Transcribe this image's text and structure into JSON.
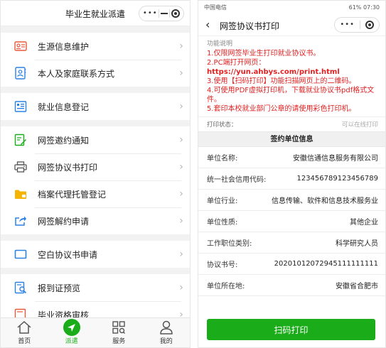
{
  "left": {
    "title": "毕业生就业派遣",
    "groups": [
      [
        {
          "label": "生源信息维护",
          "icon": "id-card-icon"
        },
        {
          "label": "本人及家庭联系方式",
          "icon": "contacts-icon"
        }
      ],
      [
        {
          "label": "就业信息登记",
          "icon": "building-icon"
        }
      ],
      [
        {
          "label": "网签邀约通知",
          "icon": "edit-document-icon"
        },
        {
          "label": "网签协议书打印",
          "icon": "printer-icon"
        },
        {
          "label": "档案代理托管登记",
          "icon": "folder-icon"
        },
        {
          "label": "网签解约申请",
          "icon": "share-out-icon"
        }
      ],
      [
        {
          "label": "空白协议书申请",
          "icon": "blank-form-icon"
        }
      ],
      [
        {
          "label": "报到证预览",
          "icon": "certificate-preview-icon"
        },
        {
          "label": "毕业资格审核",
          "icon": "review-icon"
        }
      ]
    ],
    "tabs": [
      {
        "label": "首页",
        "icon": "home-icon"
      },
      {
        "label": "派遣",
        "icon": "send-icon"
      },
      {
        "label": "服务",
        "icon": "grid-icon"
      },
      {
        "label": "我的",
        "icon": "user-icon"
      }
    ]
  },
  "right": {
    "status": {
      "carrier": "中国电信",
      "right": "61%",
      "time": "07:30"
    },
    "title": "网签协议书打印",
    "func_title": "功能说明",
    "instructions": [
      "1.仅限网签毕业生打印就业协议书。",
      "2.PC端打开网页：",
      "https://yun.ahbys.com/print.html",
      "3.使用【扫码打印】功能扫描网页上的二维码。",
      "4.可使用PDF虚拟打印机，下载就业协议书pdf格式文件。",
      "5.套印本校就业部门公章的请使用彩色打印机。"
    ],
    "print_status_label": "打印状态：",
    "print_status_value": "可以在线打印",
    "section_title": "签约单位信息",
    "fields": [
      {
        "k": "单位名称:",
        "v": "安徽信通信息服务有限公司"
      },
      {
        "k": "统一社会信用代码:",
        "v": "12345678912345678​9"
      },
      {
        "k": "单位行业:",
        "v": "信息传输、软件和信息技术服务业"
      },
      {
        "k": "单位性质:",
        "v": "其他企业"
      },
      {
        "k": "工作职位类别:",
        "v": "科学研究人员"
      },
      {
        "k": "协议书号:",
        "v": "20201012072945111111111"
      },
      {
        "k": "单位所在地:",
        "v": "安徽省合肥市"
      }
    ],
    "button_label": "扫码打印"
  }
}
